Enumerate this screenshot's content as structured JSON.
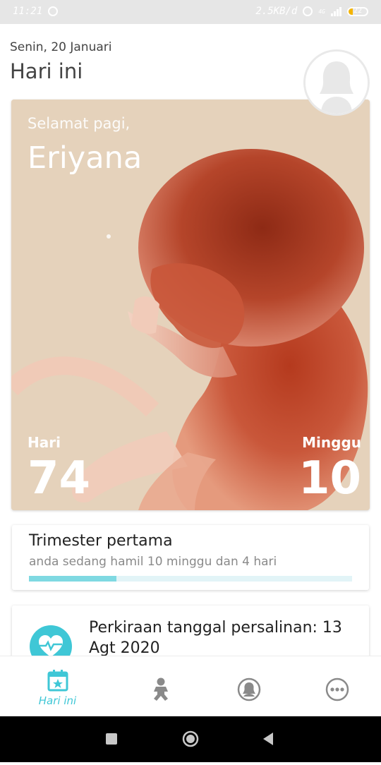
{
  "status_bar": {
    "time": "11:21",
    "net_speed": "2.5KB/d",
    "network_type": "4G",
    "battery": "22"
  },
  "header": {
    "date": "Senin, 20 Januari",
    "title": "Hari ini"
  },
  "hero": {
    "greeting": "Selamat pagi,",
    "name": "Eriyana",
    "days_label": "Hari",
    "days_value": "74",
    "weeks_label": "Minggu",
    "weeks_value": "10"
  },
  "trimester": {
    "title": "Trimester pertama",
    "subtitle": "anda sedang hamil 10 minggu dan 4 hari",
    "progress": 0.27
  },
  "due_date": {
    "text": "Perkiraan tanggal persalinan: 13 Agt 2020"
  },
  "bottom_nav": {
    "items": [
      {
        "label": "Hari ini",
        "icon": "calendar-star-icon",
        "active": true
      },
      {
        "label": "",
        "icon": "baby-icon",
        "active": false
      },
      {
        "label": "",
        "icon": "profile-icon",
        "active": false
      },
      {
        "label": "",
        "icon": "more-icon",
        "active": false
      }
    ]
  },
  "colors": {
    "accent": "#3fc7d6",
    "progress_track": "#e2f4f7",
    "progress_fill": "#7fd9e2"
  }
}
